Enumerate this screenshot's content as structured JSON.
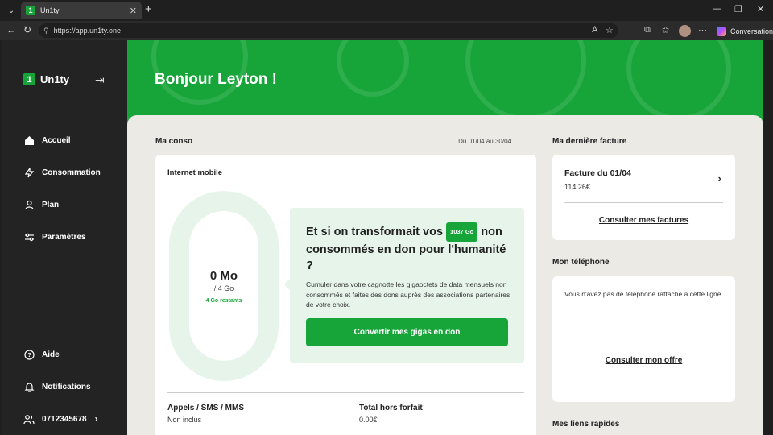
{
  "browser": {
    "tab_favicon": "1",
    "tab_title": "Un1ty",
    "url": "https://app.un1ty.one",
    "copilot_label": "Conversation"
  },
  "sidebar": {
    "logo_badge": "1",
    "logo_text": "Un1ty",
    "nav": [
      {
        "label": "Accueil",
        "icon": "home-icon"
      },
      {
        "label": "Consommation",
        "icon": "lightning-icon"
      },
      {
        "label": "Plan",
        "icon": "person-icon"
      },
      {
        "label": "Paramètres",
        "icon": "sliders-icon"
      }
    ],
    "bottom": [
      {
        "label": "Aide",
        "icon": "help-icon"
      },
      {
        "label": "Notifications",
        "icon": "bell-icon"
      },
      {
        "label": "0712345678",
        "icon": "users-icon"
      }
    ]
  },
  "hero": {
    "greeting": "Bonjour Leyton !"
  },
  "conso": {
    "title": "Ma conso",
    "period": "Du 01/04 au 30/04",
    "internet": {
      "label": "Internet mobile",
      "used": "0 Mo",
      "total": "/ 4 Go",
      "remaining": "4 Go restants",
      "remaining_fraction": 1.0
    },
    "promo": {
      "title_before": "Et si on transformait vos",
      "badge": "1037 Go",
      "title_after": "non consommés en don pour l'humanité ?",
      "description": "Cumuler dans votre cagnotte les gigaoctets de data mensuels non consommés et faites des dons auprès des associations partenaires de votre choix.",
      "button": "Convertir mes gigas en don"
    },
    "calls": {
      "title": "Appels / SMS / MMS",
      "value": "Non inclus"
    },
    "extra": {
      "title": "Total hors forfait",
      "value": "0.00€"
    }
  },
  "invoice": {
    "title": "Ma dernière facture",
    "item_title": "Facture du 01/04",
    "amount": "114.26€",
    "link": "Consulter mes factures"
  },
  "phone": {
    "title": "Mon téléphone",
    "text": "Vous n'avez pas de téléphone rattaché à cette ligne.",
    "link": "Consulter mon offre"
  },
  "quick_links": {
    "title": "Mes liens rapides"
  },
  "colors": {
    "brand_green": "#17a539",
    "light_green": "#e6f4ea",
    "sidebar": "#232323"
  }
}
